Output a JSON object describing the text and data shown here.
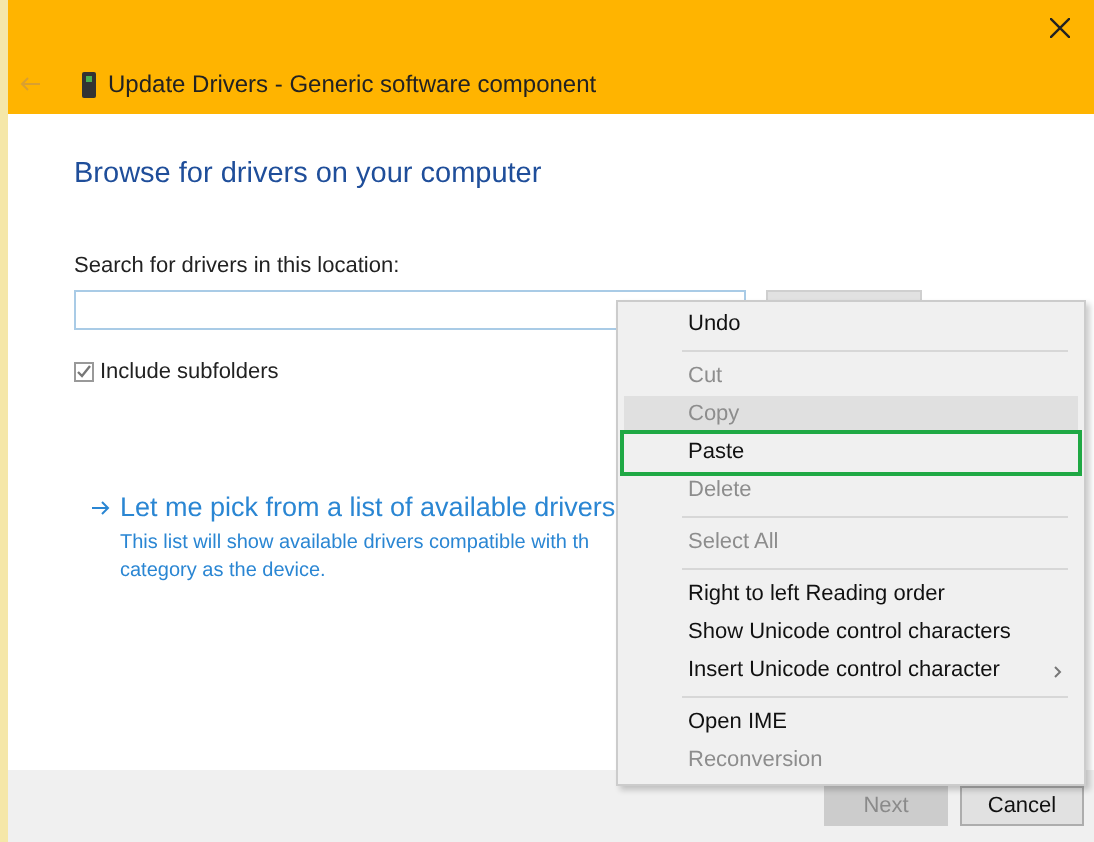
{
  "window": {
    "title": "Update Drivers - Generic software component"
  },
  "heading": "Browse for drivers on your computer",
  "search": {
    "label": "Search for drivers in this location:"
  },
  "include_subfolders": {
    "label": "Include subfolders",
    "checked": true
  },
  "pick_link": {
    "title": "Let me pick from a list of available drivers",
    "description": [
      "This list will show available drivers compatible with th",
      "category as the device."
    ]
  },
  "context_menu": [
    {
      "kind": "item",
      "label": "Undo",
      "disabled": false,
      "hovered": false,
      "highlighted": false
    },
    {
      "kind": "separator"
    },
    {
      "kind": "item",
      "label": "Cut",
      "disabled": true,
      "hovered": false,
      "highlighted": false
    },
    {
      "kind": "item",
      "label": "Copy",
      "disabled": true,
      "hovered": true,
      "highlighted": false
    },
    {
      "kind": "item",
      "label": "Paste",
      "disabled": false,
      "hovered": false,
      "highlighted": true
    },
    {
      "kind": "item",
      "label": "Delete",
      "disabled": true,
      "hovered": false,
      "highlighted": false
    },
    {
      "kind": "separator"
    },
    {
      "kind": "item",
      "label": "Select All",
      "disabled": true,
      "hovered": false,
      "highlighted": false
    },
    {
      "kind": "separator"
    },
    {
      "kind": "item",
      "label": "Right to left Reading order",
      "disabled": false,
      "hovered": false,
      "highlighted": false
    },
    {
      "kind": "item",
      "label": "Show Unicode control characters",
      "disabled": false,
      "hovered": false,
      "highlighted": false
    },
    {
      "kind": "submenu",
      "label": "Insert Unicode control character",
      "disabled": false,
      "hovered": false,
      "highlighted": false
    },
    {
      "kind": "separator"
    },
    {
      "kind": "item",
      "label": "Open IME",
      "disabled": false,
      "hovered": false,
      "highlighted": false
    },
    {
      "kind": "item",
      "label": "Reconversion",
      "disabled": true,
      "hovered": false,
      "highlighted": false
    }
  ],
  "buttons": [
    {
      "label": "Next",
      "disabled": true
    },
    {
      "label": "Cancel",
      "disabled": false
    }
  ]
}
